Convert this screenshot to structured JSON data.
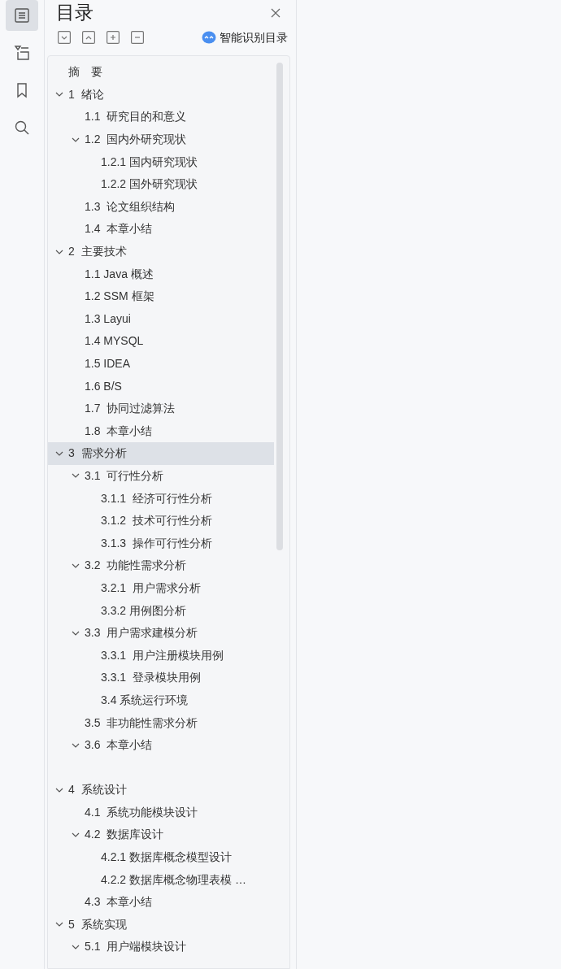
{
  "rail": [
    {
      "kind": "contents",
      "selected": true
    },
    {
      "kind": "outline",
      "selected": false
    },
    {
      "kind": "bookmarks",
      "selected": false
    },
    {
      "kind": "search",
      "selected": false
    }
  ],
  "panel": {
    "title": "目录",
    "toolbar": [
      {
        "kind": "collapse"
      },
      {
        "kind": "expand"
      },
      {
        "kind": "plus"
      },
      {
        "kind": "minus"
      }
    ],
    "smart_button": "智能识别目录"
  },
  "toc": [
    {
      "label": "摘　要",
      "selected": false
    },
    {
      "label": "1  绪论",
      "selected": false,
      "expanded": true,
      "children": [
        {
          "label": "1.1  研究目的和意义",
          "selected": false
        },
        {
          "label": "1.2  国内外研究现状",
          "selected": false,
          "expanded": true,
          "children": [
            {
              "label": "1.2.1 国内研究现状",
              "selected": false
            },
            {
              "label": "1.2.2 国外研究现状",
              "selected": false
            }
          ]
        },
        {
          "label": "1.3  论文组织结构",
          "selected": false
        },
        {
          "label": "1.4  本章小结",
          "selected": false
        }
      ]
    },
    {
      "label": "2  主要技术",
      "selected": false,
      "expanded": true,
      "children": [
        {
          "label": "1.1 Java 概述",
          "selected": false
        },
        {
          "label": "1.2 SSM 框架",
          "selected": false
        },
        {
          "label": "1.3 Layui",
          "selected": false
        },
        {
          "label": "1.4 MYSQL",
          "selected": false
        },
        {
          "label": "1.5 IDEA",
          "selected": false
        },
        {
          "label": "1.6 B/S",
          "selected": false
        },
        {
          "label": "1.7  协同过滤算法",
          "selected": false
        },
        {
          "label": "1.8  本章小结",
          "selected": false
        }
      ]
    },
    {
      "label": "3  需求分析",
      "selected": true,
      "expanded": true,
      "children": [
        {
          "label": "3.1  可行性分析",
          "selected": false,
          "expanded": true,
          "children": [
            {
              "label": "3.1.1  经济可行性分析",
              "selected": false
            },
            {
              "label": "3.1.2  技术可行性分析",
              "selected": false
            },
            {
              "label": "3.1.3  操作可行性分析",
              "selected": false
            }
          ]
        },
        {
          "label": "3.2  功能性需求分析",
          "selected": false,
          "expanded": true,
          "children": [
            {
              "label": "3.2.1  用户需求分析",
              "selected": false
            },
            {
              "label": "3.3.2 用例图分析",
              "selected": false
            }
          ]
        },
        {
          "label": "3.3  用户需求建模分析",
          "selected": false,
          "expanded": true,
          "children": [
            {
              "label": "3.3.1  用户注册模块用例",
              "selected": false
            },
            {
              "label": "3.3.1  登录模块用例",
              "selected": false
            },
            {
              "label": "3.4 系统运行环境",
              "selected": false
            }
          ]
        },
        {
          "label": "3.5  非功能性需求分析",
          "selected": false
        },
        {
          "label": "3.6  本章小结",
          "selected": false,
          "expanded": true
        }
      ]
    },
    {
      "label": "4  系统设计",
      "selected": false,
      "expanded": true,
      "children": [
        {
          "label": "4.1  系统功能模块设计",
          "selected": false
        },
        {
          "label": "4.2  数据库设计",
          "selected": false,
          "expanded": true,
          "children": [
            {
              "label": "4.2.1 数据库概念模型设计",
              "selected": false
            },
            {
              "label": "4.2.2 数据库概念物理表模 …",
              "selected": false
            }
          ]
        },
        {
          "label": "4.3  本章小结",
          "selected": false
        }
      ]
    },
    {
      "label": "5  系统实现",
      "selected": false,
      "expanded": true,
      "children": [
        {
          "label": "5.1  用户端模块设计",
          "selected": false,
          "expanded": true
        }
      ]
    }
  ]
}
